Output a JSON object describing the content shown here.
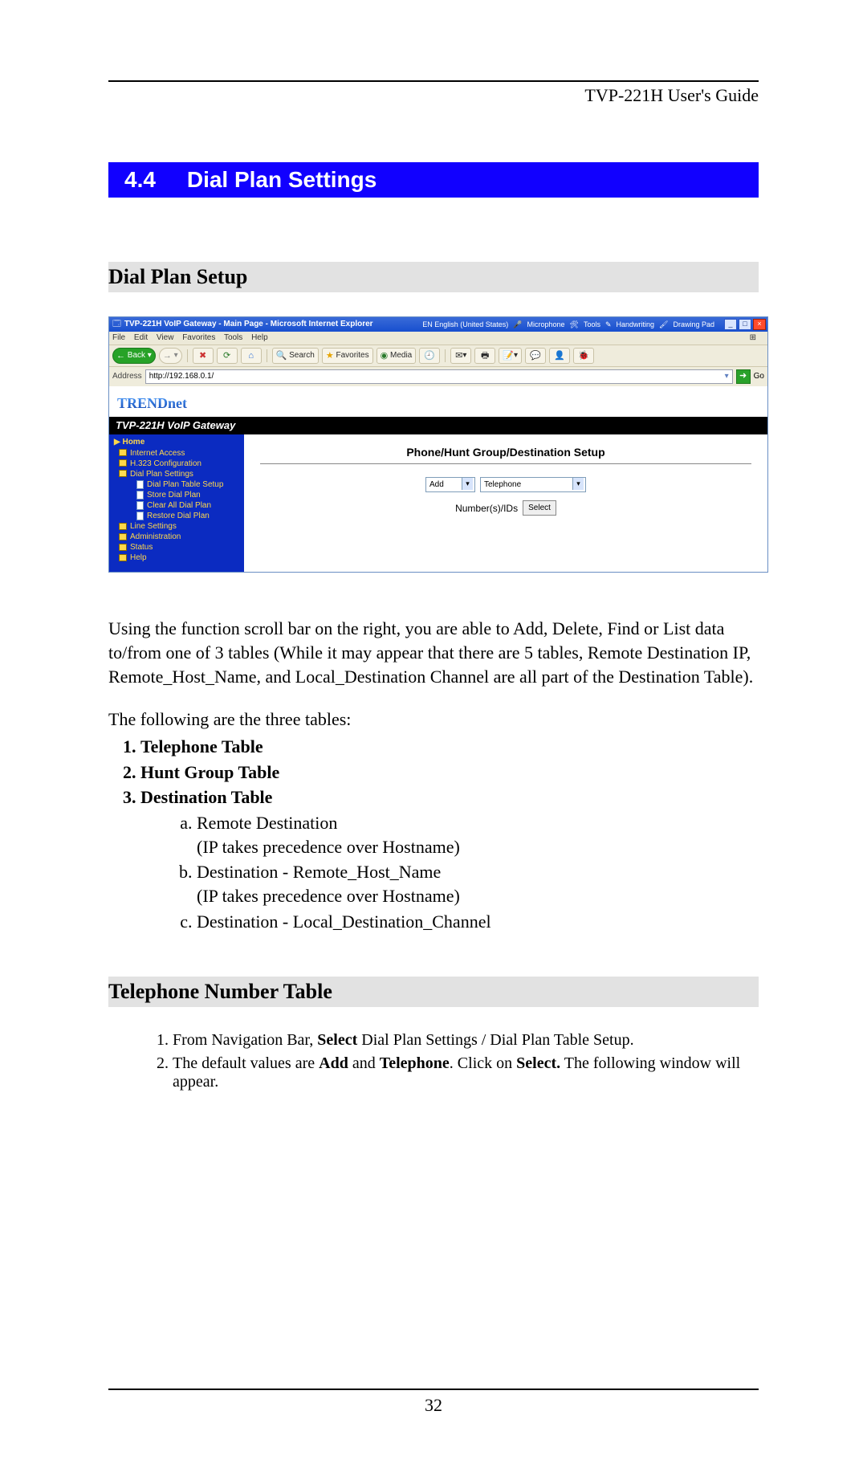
{
  "header": {
    "guide_title": "TVP-221H User's Guide"
  },
  "section": {
    "number": "4.4",
    "title": "Dial Plan Settings"
  },
  "sub1": {
    "title": "Dial Plan Setup"
  },
  "sub2": {
    "title": "Telephone Number Table"
  },
  "app": {
    "title": "TVP-221H VoIP Gateway - Main Page - Microsoft Internet Explorer",
    "langbar": {
      "lang": "EN English (United States)",
      "mic": "Microphone",
      "tools": "Tools",
      "hand": "Handwriting",
      "draw": "Drawing Pad"
    },
    "menus": [
      "File",
      "Edit",
      "View",
      "Favorites",
      "Tools",
      "Help"
    ],
    "toolbar": {
      "back": "Back",
      "search": "Search",
      "favorites": "Favorites",
      "media": "Media"
    },
    "address": {
      "label": "Address",
      "value": "http://192.168.0.1/",
      "go": "Go"
    },
    "brand": "TRENDnet",
    "gateway_title": "TVP-221H VoIP Gateway",
    "nav": {
      "home": "Home",
      "items": [
        "Internet Access",
        "H.323 Configuration",
        "Dial Plan Settings",
        "Line Settings",
        "Administration",
        "Status",
        "Help"
      ],
      "dialplan_children": [
        "Dial Plan Table Setup",
        "Store Dial Plan",
        "Clear All Dial Plan",
        "Restore Dial Plan"
      ]
    },
    "content": {
      "heading": "Phone/Hunt Group/Destination Setup",
      "action_select": "Add",
      "type_select": "Telephone",
      "ids_label": "Number(s)/IDs",
      "select_btn": "Select"
    }
  },
  "body": {
    "para1": "Using the function scroll bar on the right, you are able to Add, Delete, Find or List data to/from one of 3 tables (While it may appear that there are 5 tables, Remote Destination IP, Remote_Host_Name, and Local_Destination Channel are all part of the Destination Table).",
    "para2": "The following are the three tables:",
    "tables": [
      "Telephone Table",
      "Hunt Group Table",
      "Destination Table"
    ],
    "dest_sub": [
      {
        "label": "Remote Destination",
        "note": "(IP takes precedence over Hostname)"
      },
      {
        "label": "Destination - Remote_Host_Name",
        "note": "(IP takes precedence over Hostname)"
      },
      {
        "label": "Destination - Local_Destination_Channel",
        "note": ""
      }
    ],
    "steps_intro": [
      {
        "pre": "From Navigation Bar, ",
        "bold1": "Select",
        "mid": "  Dial Plan Settings / Dial Plan Table Setup."
      },
      {
        "pre": "The default values are ",
        "bold1": "Add",
        "mid": " and ",
        "bold2": "Telephone",
        "post": ". Click on ",
        "bold3": "Select.",
        "tail": " The following window will appear."
      }
    ]
  },
  "page_number": "32"
}
